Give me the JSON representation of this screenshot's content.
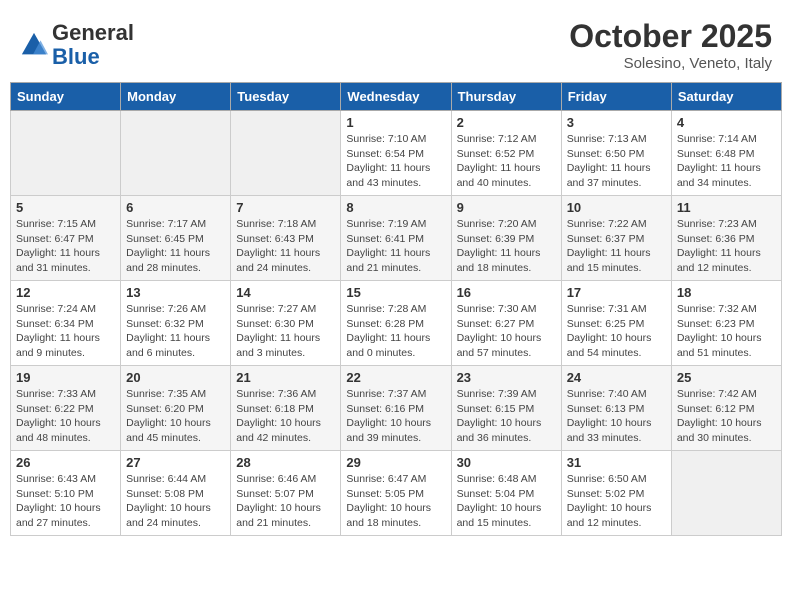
{
  "header": {
    "logo_general": "General",
    "logo_blue": "Blue",
    "month_title": "October 2025",
    "subtitle": "Solesino, Veneto, Italy"
  },
  "days_of_week": [
    "Sunday",
    "Monday",
    "Tuesday",
    "Wednesday",
    "Thursday",
    "Friday",
    "Saturday"
  ],
  "weeks": [
    [
      {
        "day": "",
        "info": ""
      },
      {
        "day": "",
        "info": ""
      },
      {
        "day": "",
        "info": ""
      },
      {
        "day": "1",
        "info": "Sunrise: 7:10 AM\nSunset: 6:54 PM\nDaylight: 11 hours\nand 43 minutes."
      },
      {
        "day": "2",
        "info": "Sunrise: 7:12 AM\nSunset: 6:52 PM\nDaylight: 11 hours\nand 40 minutes."
      },
      {
        "day": "3",
        "info": "Sunrise: 7:13 AM\nSunset: 6:50 PM\nDaylight: 11 hours\nand 37 minutes."
      },
      {
        "day": "4",
        "info": "Sunrise: 7:14 AM\nSunset: 6:48 PM\nDaylight: 11 hours\nand 34 minutes."
      }
    ],
    [
      {
        "day": "5",
        "info": "Sunrise: 7:15 AM\nSunset: 6:47 PM\nDaylight: 11 hours\nand 31 minutes."
      },
      {
        "day": "6",
        "info": "Sunrise: 7:17 AM\nSunset: 6:45 PM\nDaylight: 11 hours\nand 28 minutes."
      },
      {
        "day": "7",
        "info": "Sunrise: 7:18 AM\nSunset: 6:43 PM\nDaylight: 11 hours\nand 24 minutes."
      },
      {
        "day": "8",
        "info": "Sunrise: 7:19 AM\nSunset: 6:41 PM\nDaylight: 11 hours\nand 21 minutes."
      },
      {
        "day": "9",
        "info": "Sunrise: 7:20 AM\nSunset: 6:39 PM\nDaylight: 11 hours\nand 18 minutes."
      },
      {
        "day": "10",
        "info": "Sunrise: 7:22 AM\nSunset: 6:37 PM\nDaylight: 11 hours\nand 15 minutes."
      },
      {
        "day": "11",
        "info": "Sunrise: 7:23 AM\nSunset: 6:36 PM\nDaylight: 11 hours\nand 12 minutes."
      }
    ],
    [
      {
        "day": "12",
        "info": "Sunrise: 7:24 AM\nSunset: 6:34 PM\nDaylight: 11 hours\nand 9 minutes."
      },
      {
        "day": "13",
        "info": "Sunrise: 7:26 AM\nSunset: 6:32 PM\nDaylight: 11 hours\nand 6 minutes."
      },
      {
        "day": "14",
        "info": "Sunrise: 7:27 AM\nSunset: 6:30 PM\nDaylight: 11 hours\nand 3 minutes."
      },
      {
        "day": "15",
        "info": "Sunrise: 7:28 AM\nSunset: 6:28 PM\nDaylight: 11 hours\nand 0 minutes."
      },
      {
        "day": "16",
        "info": "Sunrise: 7:30 AM\nSunset: 6:27 PM\nDaylight: 10 hours\nand 57 minutes."
      },
      {
        "day": "17",
        "info": "Sunrise: 7:31 AM\nSunset: 6:25 PM\nDaylight: 10 hours\nand 54 minutes."
      },
      {
        "day": "18",
        "info": "Sunrise: 7:32 AM\nSunset: 6:23 PM\nDaylight: 10 hours\nand 51 minutes."
      }
    ],
    [
      {
        "day": "19",
        "info": "Sunrise: 7:33 AM\nSunset: 6:22 PM\nDaylight: 10 hours\nand 48 minutes."
      },
      {
        "day": "20",
        "info": "Sunrise: 7:35 AM\nSunset: 6:20 PM\nDaylight: 10 hours\nand 45 minutes."
      },
      {
        "day": "21",
        "info": "Sunrise: 7:36 AM\nSunset: 6:18 PM\nDaylight: 10 hours\nand 42 minutes."
      },
      {
        "day": "22",
        "info": "Sunrise: 7:37 AM\nSunset: 6:16 PM\nDaylight: 10 hours\nand 39 minutes."
      },
      {
        "day": "23",
        "info": "Sunrise: 7:39 AM\nSunset: 6:15 PM\nDaylight: 10 hours\nand 36 minutes."
      },
      {
        "day": "24",
        "info": "Sunrise: 7:40 AM\nSunset: 6:13 PM\nDaylight: 10 hours\nand 33 minutes."
      },
      {
        "day": "25",
        "info": "Sunrise: 7:42 AM\nSunset: 6:12 PM\nDaylight: 10 hours\nand 30 minutes."
      }
    ],
    [
      {
        "day": "26",
        "info": "Sunrise: 6:43 AM\nSunset: 5:10 PM\nDaylight: 10 hours\nand 27 minutes."
      },
      {
        "day": "27",
        "info": "Sunrise: 6:44 AM\nSunset: 5:08 PM\nDaylight: 10 hours\nand 24 minutes."
      },
      {
        "day": "28",
        "info": "Sunrise: 6:46 AM\nSunset: 5:07 PM\nDaylight: 10 hours\nand 21 minutes."
      },
      {
        "day": "29",
        "info": "Sunrise: 6:47 AM\nSunset: 5:05 PM\nDaylight: 10 hours\nand 18 minutes."
      },
      {
        "day": "30",
        "info": "Sunrise: 6:48 AM\nSunset: 5:04 PM\nDaylight: 10 hours\nand 15 minutes."
      },
      {
        "day": "31",
        "info": "Sunrise: 6:50 AM\nSunset: 5:02 PM\nDaylight: 10 hours\nand 12 minutes."
      },
      {
        "day": "",
        "info": ""
      }
    ]
  ]
}
